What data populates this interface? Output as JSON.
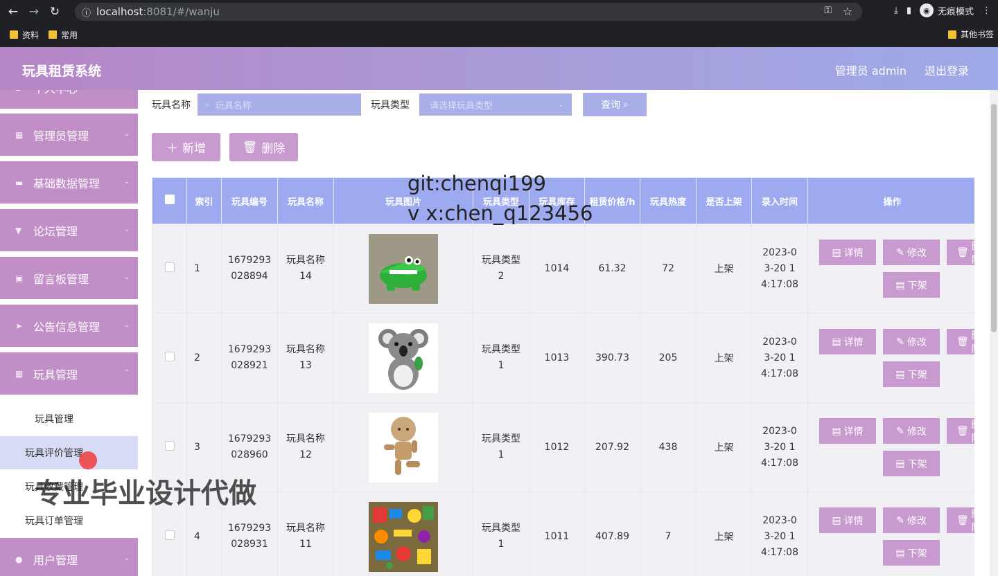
{
  "browser": {
    "url_host": "localhost",
    "url_path": ":8081/#/wanju",
    "incognito_label": "无痕模式",
    "bookmarks": [
      "资料",
      "常用"
    ],
    "other_bookmarks": "其他书签"
  },
  "header": {
    "title": "玩具租赁系统",
    "user": "管理员 admin",
    "logout": "退出登录"
  },
  "sidebar": {
    "top_partial": "个人中心",
    "items": [
      {
        "label": "管理员管理",
        "icon": "grid-icon"
      },
      {
        "label": "基础数据管理",
        "icon": "chat-icon"
      },
      {
        "label": "论坛管理",
        "icon": "forum-icon"
      },
      {
        "label": "留言板管理",
        "icon": "clipboard-icon"
      },
      {
        "label": "公告信息管理",
        "icon": "send-icon"
      },
      {
        "label": "玩具管理",
        "icon": "grid-icon"
      }
    ],
    "sub_items": [
      "玩具管理",
      "玩具评价管理",
      "玩具收藏管理",
      "玩具订单管理"
    ],
    "bottom_item": "用户管理"
  },
  "filters": {
    "name_label": "玩具名称",
    "name_placeholder": "玩具名称",
    "type_label": "玩具类型",
    "type_placeholder": "请选择玩具类型",
    "query_button": "查询"
  },
  "actions": {
    "add": "新增",
    "delete": "删除"
  },
  "table": {
    "headers": [
      "索引",
      "玩具编号",
      "玩具名称",
      "玩具图片",
      "玩具类型",
      "玩具库存",
      "租赁价格/h",
      "玩具热度",
      "是否上架",
      "录入时间",
      "操作"
    ],
    "rows": [
      {
        "index": "1",
        "code": "1679293028894",
        "name": "玩具名称14",
        "type": "玩具类型2",
        "stock": "1014",
        "price": "61.32",
        "heat": "72",
        "status": "上架",
        "time": "2023-03-20 14:17:08",
        "image": "crocodile"
      },
      {
        "index": "2",
        "code": "1679293028921",
        "name": "玩具名称13",
        "type": "玩具类型1",
        "stock": "1013",
        "price": "390.73",
        "heat": "205",
        "status": "上架",
        "time": "2023-03-20 14:17:08",
        "image": "koala"
      },
      {
        "index": "3",
        "code": "1679293028960",
        "name": "玩具名称12",
        "type": "玩具类型1",
        "stock": "1012",
        "price": "207.92",
        "heat": "438",
        "status": "上架",
        "time": "2023-03-20 14:17:08",
        "image": "wooden-figure"
      },
      {
        "index": "4",
        "code": "1679293028931",
        "name": "玩具名称11",
        "type": "玩具类型1",
        "stock": "1011",
        "price": "407.89",
        "heat": "7",
        "status": "上架",
        "time": "2023-03-20 14:17:08",
        "image": "toy-pile"
      }
    ],
    "op_labels": {
      "detail": "详情",
      "edit": "修改",
      "remove": "删除",
      "offshelf": "下架"
    }
  },
  "watermarks": {
    "line1": "git:chenqi199",
    "line2": "v x:chen_q123456",
    "big": "专业毕业设计代做"
  }
}
